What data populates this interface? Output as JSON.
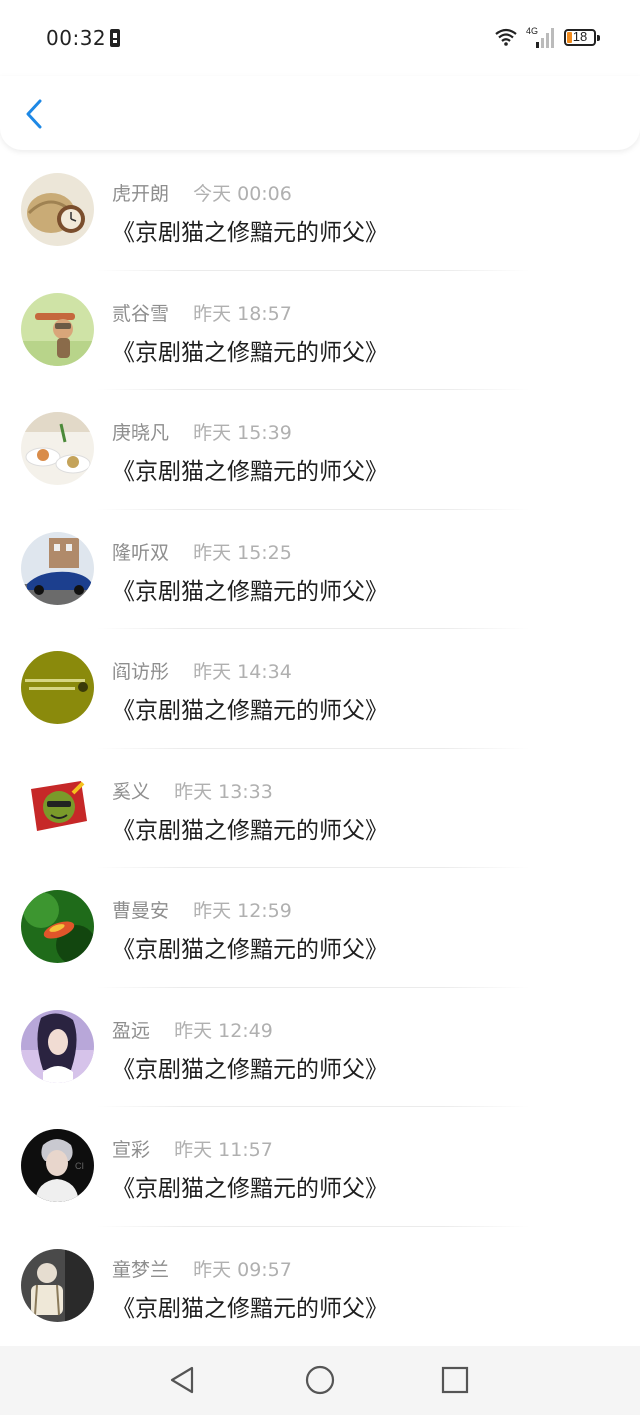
{
  "status_bar": {
    "time": "00:32",
    "network": "4G",
    "battery_level": "18",
    "battery_color": "#f08a1c"
  },
  "header": {
    "back_icon": "chevron-left-icon",
    "accent": "#1e88e5"
  },
  "list": {
    "items": [
      {
        "name": "虎开朗",
        "time": "今天 00:06",
        "message": "《京剧猫之修黯元的师父》",
        "avatar": "basket-clock-photo"
      },
      {
        "name": "贰谷雪",
        "time": "昨天 18:57",
        "message": "《京剧猫之修黯元的师父》",
        "avatar": "toy-pilot-photo"
      },
      {
        "name": "庚晓凡",
        "time": "昨天 15:39",
        "message": "《京剧猫之修黯元的师父》",
        "avatar": "food-plates-photo"
      },
      {
        "name": "隆听双",
        "time": "昨天 15:25",
        "message": "《京剧猫之修黯元的师父》",
        "avatar": "blue-car-photo"
      },
      {
        "name": "阎访彤",
        "time": "昨天 14:34",
        "message": "《京剧猫之修黯元的师父》",
        "avatar": "olive-text-photo"
      },
      {
        "name": "奚义",
        "time": "昨天 13:33",
        "message": "《京剧猫之修黯元的师父》",
        "avatar": "cartoon-badge-photo"
      },
      {
        "name": "曹曼安",
        "time": "昨天 12:59",
        "message": "《京剧猫之修黯元的师父》",
        "avatar": "green-leaf-photo"
      },
      {
        "name": "盈远",
        "time": "昨天 12:49",
        "message": "《京剧猫之修黯元的师父》",
        "avatar": "anime-girl-photo"
      },
      {
        "name": "宣彩",
        "time": "昨天 11:57",
        "message": "《京剧猫之修黯元的师父》",
        "avatar": "portrait-dark-photo"
      },
      {
        "name": "童梦兰",
        "time": "昨天 09:57",
        "message": "《京剧猫之修黯元的师父》",
        "avatar": "backpack-photo"
      }
    ]
  },
  "nav_bar": {
    "back_icon": "triangle-back-icon",
    "home_icon": "circle-home-icon",
    "recents_icon": "square-recents-icon"
  }
}
